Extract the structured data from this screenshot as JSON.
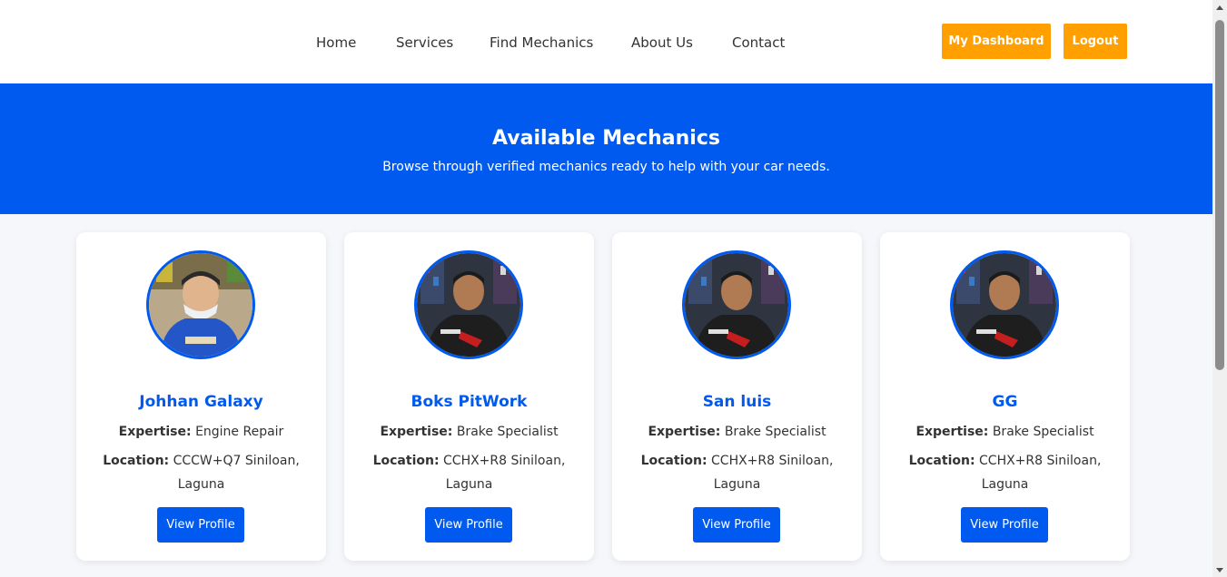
{
  "colors": {
    "primary": "#005af0",
    "accent": "#ff9f00",
    "background": "#f5f7fa",
    "text": "#333333"
  },
  "nav": {
    "home": "Home",
    "services": "Services",
    "find_mechanics": "Find Mechanics",
    "about": "About Us",
    "contact": "Contact"
  },
  "header_buttons": {
    "dashboard": "My Dashboard",
    "logout": "Logout"
  },
  "hero": {
    "title": "Available Mechanics",
    "subtitle": "Browse through verified mechanics ready to help with your car needs."
  },
  "labels": {
    "expertise": "Expertise:",
    "location": "Location:",
    "view_profile": "View Profile"
  },
  "mechanics": [
    {
      "name": "Johhan Galaxy",
      "expertise": "Engine Repair",
      "location": "CCCW+Q7 Siniloan, Laguna"
    },
    {
      "name": "Boks PitWork",
      "expertise": "Brake Specialist",
      "location": "CCHX+R8 Siniloan, Laguna"
    },
    {
      "name": "San luis",
      "expertise": "Brake Specialist",
      "location": "CCHX+R8 Siniloan, Laguna"
    },
    {
      "name": "GG",
      "expertise": "Brake Specialist",
      "location": "CCHX+R8 Siniloan, Laguna"
    }
  ]
}
